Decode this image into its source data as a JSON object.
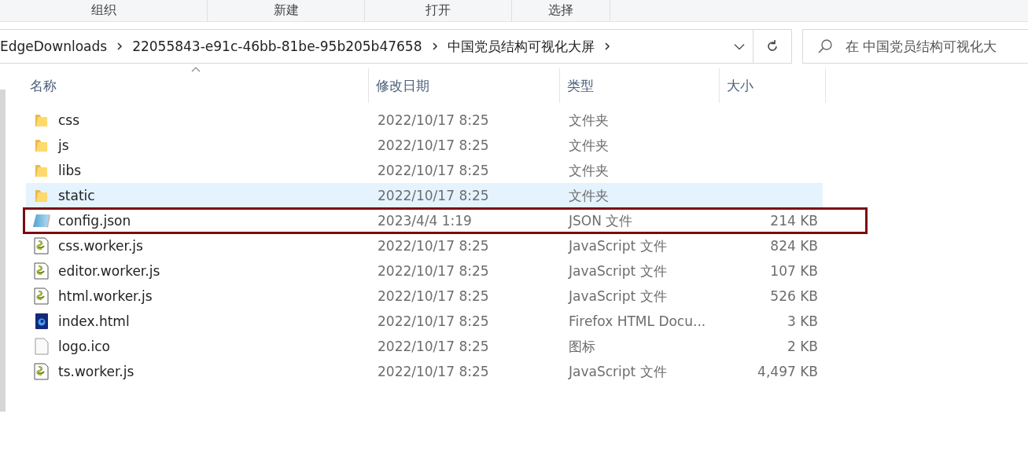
{
  "toolbar": {
    "groups": [
      {
        "label": "组织"
      },
      {
        "label": "新建"
      },
      {
        "label": "打开"
      },
      {
        "label": "选择"
      }
    ]
  },
  "address_bar": {
    "path": [
      {
        "label": "EdgeDownloads"
      },
      {
        "label": "22055843-e91c-46bb-81be-95b205b47658"
      },
      {
        "label": "中国党员结构可视化大屏"
      }
    ]
  },
  "search": {
    "placeholder": "在 中国党员结构可视化大"
  },
  "table": {
    "columns": [
      {
        "label": "名称",
        "sorted": true
      },
      {
        "label": "修改日期",
        "sorted": false
      },
      {
        "label": "类型",
        "sorted": false
      },
      {
        "label": "大小",
        "sorted": false
      }
    ],
    "rows": [
      {
        "kind": "folder",
        "name": "css",
        "date": "2022/10/17 8:25",
        "type": "文件夹",
        "size": "",
        "hovered": false,
        "outlined": false
      },
      {
        "kind": "folder",
        "name": "js",
        "date": "2022/10/17 8:25",
        "type": "文件夹",
        "size": "",
        "hovered": false,
        "outlined": false
      },
      {
        "kind": "folder",
        "name": "libs",
        "date": "2022/10/17 8:25",
        "type": "文件夹",
        "size": "",
        "hovered": false,
        "outlined": false
      },
      {
        "kind": "folder",
        "name": "static",
        "date": "2022/10/17 8:25",
        "type": "文件夹",
        "size": "",
        "hovered": true,
        "outlined": false
      },
      {
        "kind": "json",
        "name": "config.json",
        "date": "2023/4/4 1:19",
        "type": "JSON 文件",
        "size": "214 KB",
        "hovered": false,
        "outlined": true
      },
      {
        "kind": "script",
        "name": "css.worker.js",
        "date": "2022/10/17 8:25",
        "type": "JavaScript 文件",
        "size": "824 KB",
        "hovered": false,
        "outlined": false
      },
      {
        "kind": "script",
        "name": "editor.worker.js",
        "date": "2022/10/17 8:25",
        "type": "JavaScript 文件",
        "size": "107 KB",
        "hovered": false,
        "outlined": false
      },
      {
        "kind": "script",
        "name": "html.worker.js",
        "date": "2022/10/17 8:25",
        "type": "JavaScript 文件",
        "size": "526 KB",
        "hovered": false,
        "outlined": false
      },
      {
        "kind": "html",
        "name": "index.html",
        "date": "2022/10/17 8:25",
        "type": "Firefox HTML Docu...",
        "size": "3 KB",
        "hovered": false,
        "outlined": false
      },
      {
        "kind": "blank",
        "name": "logo.ico",
        "date": "2022/10/17 8:25",
        "type": "图标",
        "size": "2 KB",
        "hovered": false,
        "outlined": false
      },
      {
        "kind": "script",
        "name": "ts.worker.js",
        "date": "2022/10/17 8:25",
        "type": "JavaScript 文件",
        "size": "4,497 KB",
        "hovered": false,
        "outlined": false
      }
    ]
  }
}
